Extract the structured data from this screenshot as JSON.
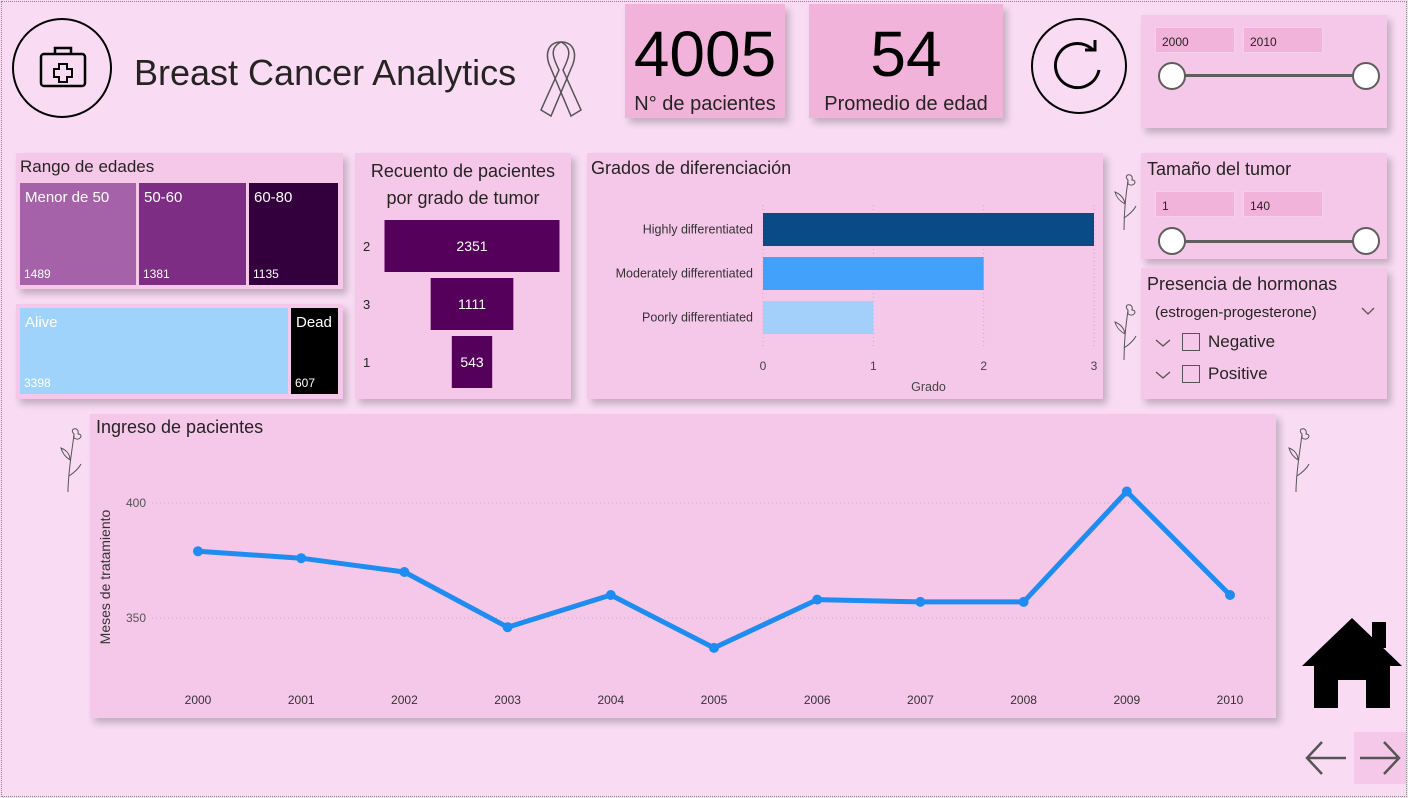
{
  "header": {
    "title": "Breast Cancer Analytics",
    "kpi_patients": {
      "value": "4005",
      "label": "N° de pacientes"
    },
    "kpi_age": {
      "value": "54",
      "label": "Promedio de edad"
    }
  },
  "year_slicer": {
    "min": "2000",
    "max": "2010"
  },
  "tumor_slicer": {
    "title": "Tamaño del tumor",
    "min": "1",
    "max": "140"
  },
  "hormones": {
    "title": "Presencia de hormonas",
    "subtitle": "(estrogen-progesterone)",
    "options": [
      "Negative",
      "Positive"
    ]
  },
  "age_ranges": {
    "title": "Rango de edades",
    "items": [
      {
        "label": "Menor de 50",
        "value": "1489",
        "color": "#a662a8"
      },
      {
        "label": "50-60",
        "value": "1381",
        "color": "#7d2d84"
      },
      {
        "label": "60-80",
        "value": "1135",
        "color": "#33003d"
      }
    ]
  },
  "status": {
    "items": [
      {
        "label": "Alive",
        "value": "3398",
        "color": "#9fd3fb"
      },
      {
        "label": "Dead",
        "value": "607",
        "color": "#000000"
      }
    ]
  },
  "chart_data": [
    {
      "type": "bar",
      "title": "Recuento de pacientes por grado de tumor",
      "orientation": "funnel",
      "categories": [
        "2",
        "3",
        "1"
      ],
      "values": [
        2351,
        1111,
        543
      ],
      "color": "#55005a"
    },
    {
      "type": "bar",
      "title": "Grados de diferenciación",
      "orientation": "horizontal",
      "categories": [
        "Highly differentiated",
        "Moderately differentiated",
        "Poorly differentiated"
      ],
      "values": [
        3,
        2,
        1
      ],
      "colors": [
        "#0a4a87",
        "#42a2fb",
        "#a2d0fb"
      ],
      "xlabel": "Grado",
      "xlim": [
        0,
        3
      ],
      "xticks": [
        "0",
        "1",
        "2",
        "3"
      ]
    },
    {
      "type": "line",
      "title": "Ingreso de pacientes",
      "ylabel": "Meses de tratamiento",
      "x": [
        "2000",
        "2001",
        "2002",
        "2003",
        "2004",
        "2005",
        "2006",
        "2007",
        "2008",
        "2009",
        "2010"
      ],
      "values": [
        379,
        376,
        370,
        346,
        360,
        337,
        358,
        357,
        357,
        405,
        360
      ],
      "yticks": [
        "350",
        "400"
      ],
      "color": "#1e8cf0"
    }
  ]
}
